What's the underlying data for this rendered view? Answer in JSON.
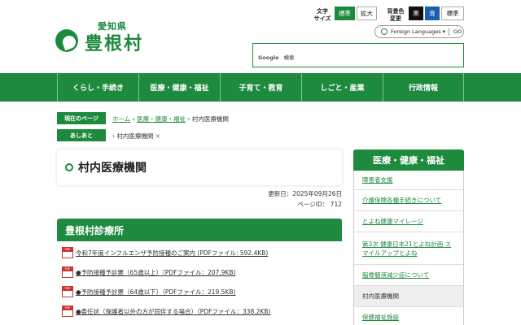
{
  "header": {
    "pref": "愛知県",
    "village": "豊根村",
    "text_size_label": "文字\nサイズ",
    "text_size_buttons": [
      "標準",
      "拡大"
    ],
    "bg_label": "背景色\n変更",
    "bg_buttons": [
      "黒",
      "青",
      "標準"
    ],
    "lang_label": "Foreign Languages ▾",
    "lang_go": "GO",
    "search_brand": "Google",
    "search_placeholder": "検索"
  },
  "nav": [
    "くらし・手続き",
    "医療・健康・福祉",
    "子育て・教育",
    "しごと・産業",
    "行政情報"
  ],
  "breadcrumb": {
    "current_label": "現在のページ",
    "home": "ホーム",
    "cat": "医療・健康・福祉",
    "page": "村内医療機関",
    "history_label": "あしあと",
    "history_item": "村内医療機関",
    "history_close": "×"
  },
  "main": {
    "title": "村内医療機関",
    "updated": "更新日：2025年09月26日",
    "page_id": "ページID： 712",
    "section": "豊根村診療所",
    "files": [
      "令和7年度インフルエンザ予防接種のご案内 (PDFファイル: 592.4KB)",
      "●予防接種予診票（65歳以上）（PDFファイル：207.9KB)",
      "●予防接種予診票（64歳以下）（PDFファイル：219.5KB)",
      "●委任状（保護者以外の方が同伴する場合）（PDFファイル：338.2KB)"
    ]
  },
  "sidebar": {
    "title": "医療・健康・福祉",
    "items": [
      "障害者支援",
      "介護保険各種手続きについて",
      "とよね健康マイレージ",
      "第3次 健康日本21とよね計画 スマイルアップとよね",
      "脳脊髄液減少症について",
      "村内医療機関",
      "保健福祉施設"
    ]
  },
  "colors": {
    "brand": "#1e8a3e"
  }
}
